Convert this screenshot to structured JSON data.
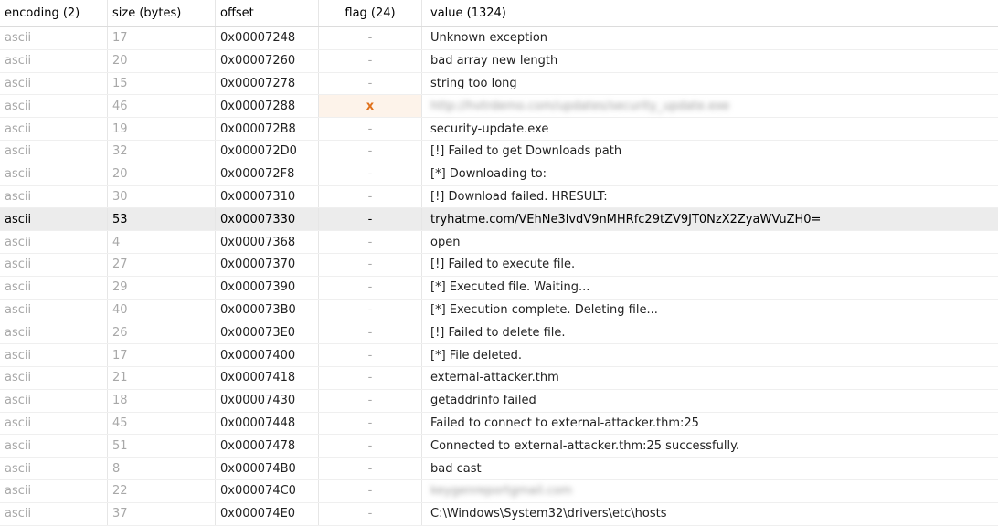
{
  "columns": {
    "encoding": "encoding (2)",
    "size": "size (bytes)",
    "offset": "offset",
    "flag": "flag (24)",
    "value": "value (1324)"
  },
  "rows": [
    {
      "encoding": "ascii",
      "size": "17",
      "offset": "0x00007248",
      "flag": "-",
      "value": "Unknown exception"
    },
    {
      "encoding": "ascii",
      "size": "20",
      "offset": "0x00007260",
      "flag": "-",
      "value": "bad array new length"
    },
    {
      "encoding": "ascii",
      "size": "15",
      "offset": "0x00007278",
      "flag": "-",
      "value": "string too long"
    },
    {
      "encoding": "ascii",
      "size": "46",
      "offset": "0x00007288",
      "flag": "x",
      "value": "http://hvtrdemo.com/updates/security_update.exe"
    },
    {
      "encoding": "ascii",
      "size": "19",
      "offset": "0x000072B8",
      "flag": "-",
      "value": "security-update.exe"
    },
    {
      "encoding": "ascii",
      "size": "32",
      "offset": "0x000072D0",
      "flag": "-",
      "value": "[!] Failed to get Downloads path"
    },
    {
      "encoding": "ascii",
      "size": "20",
      "offset": "0x000072F8",
      "flag": "-",
      "value": "[*] Downloading to:"
    },
    {
      "encoding": "ascii",
      "size": "30",
      "offset": "0x00007310",
      "flag": "-",
      "value": "[!] Download failed. HRESULT:"
    },
    {
      "encoding": "ascii",
      "size": "53",
      "offset": "0x00007330",
      "flag": "-",
      "value": "tryhatme.com/VEhNe3lvdV9nMHRfc29tZV9JT0NzX2ZyaWVuZH0="
    },
    {
      "encoding": "ascii",
      "size": "4",
      "offset": "0x00007368",
      "flag": "-",
      "value": "open"
    },
    {
      "encoding": "ascii",
      "size": "27",
      "offset": "0x00007370",
      "flag": "-",
      "value": "[!] Failed to execute file."
    },
    {
      "encoding": "ascii",
      "size": "29",
      "offset": "0x00007390",
      "flag": "-",
      "value": "[*] Executed file. Waiting..."
    },
    {
      "encoding": "ascii",
      "size": "40",
      "offset": "0x000073B0",
      "flag": "-",
      "value": "[*] Execution complete. Deleting file..."
    },
    {
      "encoding": "ascii",
      "size": "26",
      "offset": "0x000073E0",
      "flag": "-",
      "value": "[!] Failed to delete file."
    },
    {
      "encoding": "ascii",
      "size": "17",
      "offset": "0x00007400",
      "flag": "-",
      "value": "[*] File deleted."
    },
    {
      "encoding": "ascii",
      "size": "21",
      "offset": "0x00007418",
      "flag": "-",
      "value": "external-attacker.thm"
    },
    {
      "encoding": "ascii",
      "size": "18",
      "offset": "0x00007430",
      "flag": "-",
      "value": "getaddrinfo failed"
    },
    {
      "encoding": "ascii",
      "size": "45",
      "offset": "0x00007448",
      "flag": "-",
      "value": "Failed to connect to external-attacker.thm:25"
    },
    {
      "encoding": "ascii",
      "size": "51",
      "offset": "0x00007478",
      "flag": "-",
      "value": "Connected to external-attacker.thm:25 successfully."
    },
    {
      "encoding": "ascii",
      "size": "8",
      "offset": "0x000074B0",
      "flag": "-",
      "value": "bad cast"
    },
    {
      "encoding": "ascii",
      "size": "22",
      "offset": "0x000074C0",
      "flag": "-",
      "value": "keygenreportgmail.com"
    },
    {
      "encoding": "ascii",
      "size": "37",
      "offset": "0x000074E0",
      "flag": "-",
      "value": "C:\\Windows\\System32\\drivers\\etc\\hosts"
    }
  ],
  "selected_index": 8,
  "blurred_indices": [
    3,
    20
  ],
  "flag_color": "#e0701a"
}
